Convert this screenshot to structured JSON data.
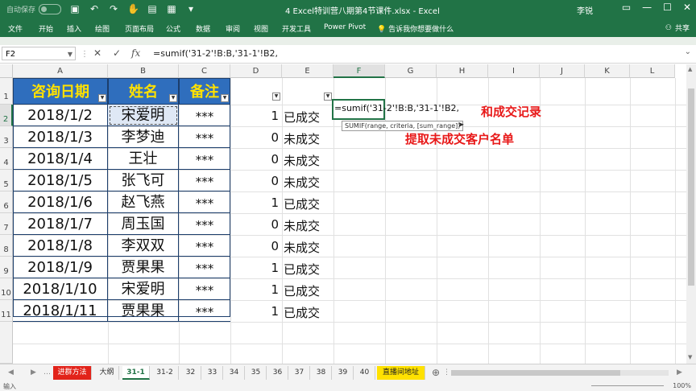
{
  "titlebar": {
    "autosave_label": "自动保存",
    "title": "4 Excel特训营八期第4节课件.xlsx - Excel",
    "user": "李锐",
    "icons": [
      "save-icon",
      "undo-icon",
      "redo-icon",
      "touch-mode-icon",
      "format-icon",
      "layout-icon",
      "customize-qa-icon"
    ]
  },
  "ribbon": {
    "tabs": [
      "文件",
      "开始",
      "插入",
      "绘图",
      "页面布局",
      "公式",
      "数据",
      "审阅",
      "视图",
      "开发工具",
      "Power Pivot"
    ],
    "tell_me": "告诉我你想要做什么",
    "share": "共享"
  },
  "formula_bar": {
    "name_box": "F2",
    "formula": "=sumif('31-2'!B:B,'31-1'!B2,"
  },
  "columns": [
    "A",
    "B",
    "C",
    "D",
    "E",
    "F",
    "G",
    "H",
    "I",
    "J",
    "K",
    "L"
  ],
  "rows": [
    "1",
    "2",
    "3",
    "4",
    "5",
    "6",
    "7",
    "8",
    "9",
    "10",
    "11"
  ],
  "table": {
    "headers": [
      "咨询日期",
      "姓名",
      "备注"
    ],
    "dates": [
      "2018/1/2",
      "2018/1/3",
      "2018/1/4",
      "2018/1/5",
      "2018/1/6",
      "2018/1/7",
      "2018/1/8",
      "2018/1/9",
      "2018/1/10",
      "2018/1/11"
    ],
    "names": [
      "宋爱明",
      "李梦迪",
      "王壮",
      "张飞可",
      "赵飞燕",
      "周玉国",
      "李双双",
      "贾果果",
      "宋爱明",
      "贾果果"
    ],
    "notes": [
      "***",
      "***",
      "***",
      "***",
      "***",
      "***",
      "***",
      "***",
      "***",
      "***"
    ],
    "flags": [
      "1",
      "0",
      "0",
      "0",
      "1",
      "0",
      "0",
      "1",
      "1",
      "1"
    ],
    "status": [
      "已成交",
      "未成交",
      "未成交",
      "未成交",
      "已成交",
      "未成交",
      "未成交",
      "已成交",
      "已成交",
      "已成交"
    ]
  },
  "edit": {
    "cell_text": "=sumif('31-2'!B:B,'31-1'!B2,",
    "tooltip": "SUMIF(range, criteria, [sum_range])",
    "annotation1": "和成交记录",
    "annotation2": "提取未成交客户名单"
  },
  "sheets": [
    "进群方法",
    "大纲",
    "31-1",
    "31-2",
    "32",
    "33",
    "34",
    "35",
    "36",
    "37",
    "38",
    "39",
    "40",
    "直播间地址"
  ],
  "active_sheet": "31-1",
  "status": {
    "mode": "输入",
    "zoom": "100%"
  },
  "colors": {
    "excel_green": "#217346",
    "header_blue": "#2f6ebd",
    "header_text": "#ffe100",
    "annotation_red": "#e81919"
  }
}
